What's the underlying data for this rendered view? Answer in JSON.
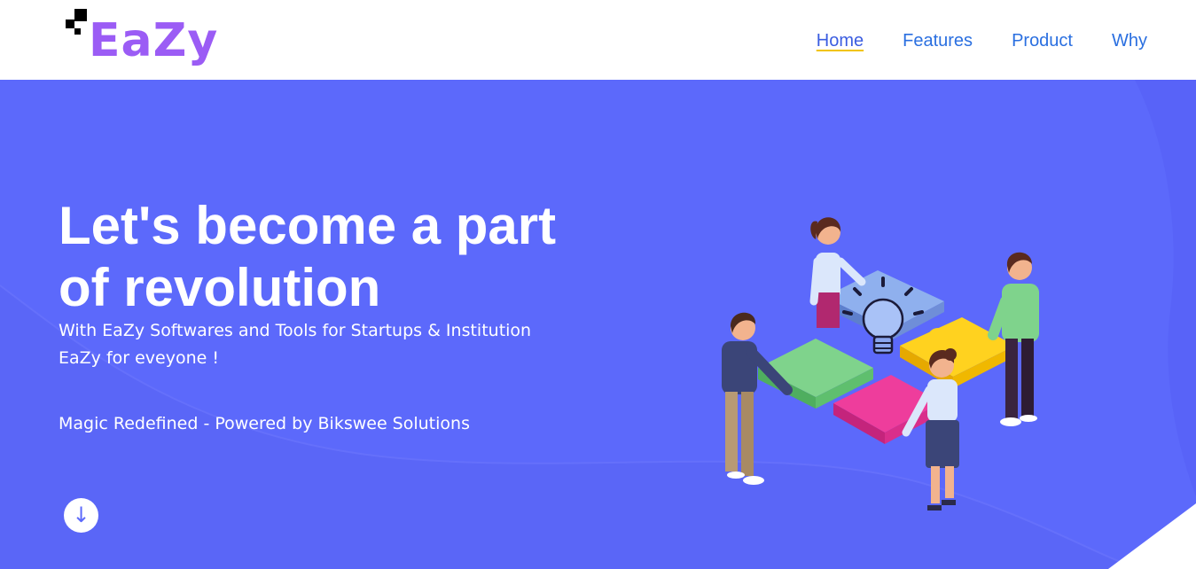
{
  "brand": {
    "name": "EaZy",
    "color": "#9b5cf5"
  },
  "nav": {
    "items": [
      {
        "label": "Home",
        "active": true
      },
      {
        "label": "Features",
        "active": false
      },
      {
        "label": "Product",
        "active": false
      },
      {
        "label": "Why",
        "active": false
      }
    ]
  },
  "hero": {
    "headline_line1": "Let's become a part",
    "headline_line2": "of revolution",
    "subtitle_line1": "With EaZy Softwares and Tools for Startups & Institution",
    "subtitle_line2": "EaZy for eveyone !",
    "tagline": "Magic Redefined - Powered by Bikswee Solutions",
    "scroll_icon": "arrow-down-icon",
    "scroll_glyph": "↓",
    "background_color": "#5c69fb",
    "illustration": "team-puzzle-lightbulb-illustration"
  },
  "colors": {
    "nav_link": "#2a6fe0",
    "nav_underline": "#f2c400",
    "hero_bg": "#5c69fb"
  }
}
